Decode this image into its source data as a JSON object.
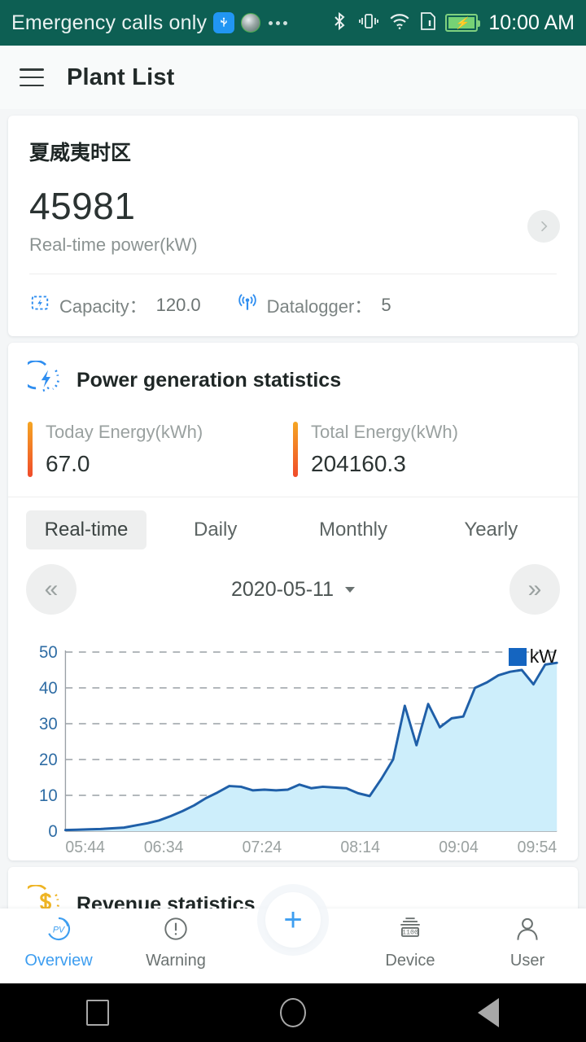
{
  "status_bar": {
    "carrier_text": "Emergency calls only",
    "time": "10:00 AM",
    "icons": [
      "usb-icon",
      "disc-icon",
      "more-dots-icon",
      "bluetooth-icon",
      "vibrate-icon",
      "wifi-icon",
      "sim-card-icon",
      "battery-charging-icon"
    ],
    "background_color": "#0d5f53"
  },
  "header": {
    "menu_icon": "hamburger-menu-icon",
    "title": "Plant List"
  },
  "plant_card": {
    "name": "夏威夷时区",
    "realtime_power": "45981",
    "realtime_power_label": "Real-time power(kW)",
    "capacity_label": "Capacity：",
    "capacity_value": "120.0",
    "datalogger_label": "Datalogger：",
    "datalogger_value": "5",
    "arrow_icon": "chevron-right-icon",
    "capacity_icon": "capacity-bolt-icon",
    "datalogger_icon": "signal-antenna-icon"
  },
  "power_section": {
    "icon": "bolt-circle-icon",
    "title": "Power generation statistics",
    "today_label": "Today Energy(kWh)",
    "today_value": "67.0",
    "total_label": "Total Energy(kWh)",
    "total_value": "204160.3",
    "accent_color": "#f04b2a",
    "tabs": [
      {
        "label": "Real-time",
        "active": true
      },
      {
        "label": "Daily",
        "active": false
      },
      {
        "label": "Monthly",
        "active": false
      },
      {
        "label": "Yearly",
        "active": false
      }
    ],
    "date_nav": {
      "prev_label": "«",
      "next_label": "»",
      "date": "2020-05-11",
      "caret_icon": "caret-down-icon"
    }
  },
  "chart_data": {
    "type": "area",
    "title": "",
    "xlabel": "",
    "ylabel": "",
    "legend": [
      {
        "name": "kW",
        "color": "#1565c0"
      }
    ],
    "legend_position": "top-right",
    "grid": true,
    "ylim": [
      0,
      50
    ],
    "yticks": [
      0,
      10,
      20,
      30,
      40,
      50
    ],
    "ytick_color": "#2e6ca4",
    "xticks": [
      "05:44",
      "06:34",
      "07:24",
      "08:14",
      "09:04",
      "09:54"
    ],
    "xlim": [
      "05:44",
      "09:54"
    ],
    "line_color": "#1f5fa8",
    "fill_color": "#cdeefb",
    "x": [
      "05:44",
      "05:54",
      "06:04",
      "06:14",
      "06:24",
      "06:34",
      "06:44",
      "06:54",
      "07:04",
      "07:09",
      "07:14",
      "07:19",
      "07:24",
      "07:29",
      "07:34",
      "07:39",
      "07:44",
      "07:49",
      "07:54",
      "07:59",
      "08:04",
      "08:09",
      "08:14",
      "08:19",
      "08:24",
      "08:29",
      "08:34",
      "08:39",
      "08:44",
      "08:49",
      "08:54",
      "08:59",
      "09:04",
      "09:09",
      "09:14",
      "09:19",
      "09:24",
      "09:29",
      "09:34",
      "09:39",
      "09:44",
      "09:49",
      "09:54"
    ],
    "values": [
      0.3,
      0.4,
      0.5,
      0.6,
      0.8,
      1.0,
      1.6,
      2.2,
      3.0,
      4.2,
      5.6,
      7.2,
      9.2,
      10.8,
      12.6,
      12.4,
      11.4,
      11.6,
      11.4,
      11.6,
      13.0,
      12.0,
      12.4,
      12.2,
      12.0,
      10.6,
      9.8,
      14.6,
      20.0,
      35.0,
      24.0,
      35.5,
      29.0,
      31.5,
      32.0,
      40.0,
      41.5,
      43.5,
      44.5,
      45.0,
      41.0,
      46.5,
      47.0
    ]
  },
  "revenue_section": {
    "icon": "dollar-circle-icon",
    "title": "Revenue statistics"
  },
  "bottom_nav": {
    "items": [
      {
        "label": "Overview",
        "icon": "pv-overview-icon",
        "active": true
      },
      {
        "label": "Warning",
        "icon": "exclamation-circle-icon",
        "active": false
      },
      {
        "label": "Device",
        "icon": "device-icon",
        "active": false
      },
      {
        "label": "User",
        "icon": "user-person-icon",
        "active": false
      }
    ],
    "fab": {
      "label": "+",
      "icon": "plus-icon"
    },
    "active_color": "#3e9ef0"
  },
  "android_nav": {
    "recents": "square-recents-icon",
    "home": "circle-home-icon",
    "back": "triangle-back-icon"
  }
}
